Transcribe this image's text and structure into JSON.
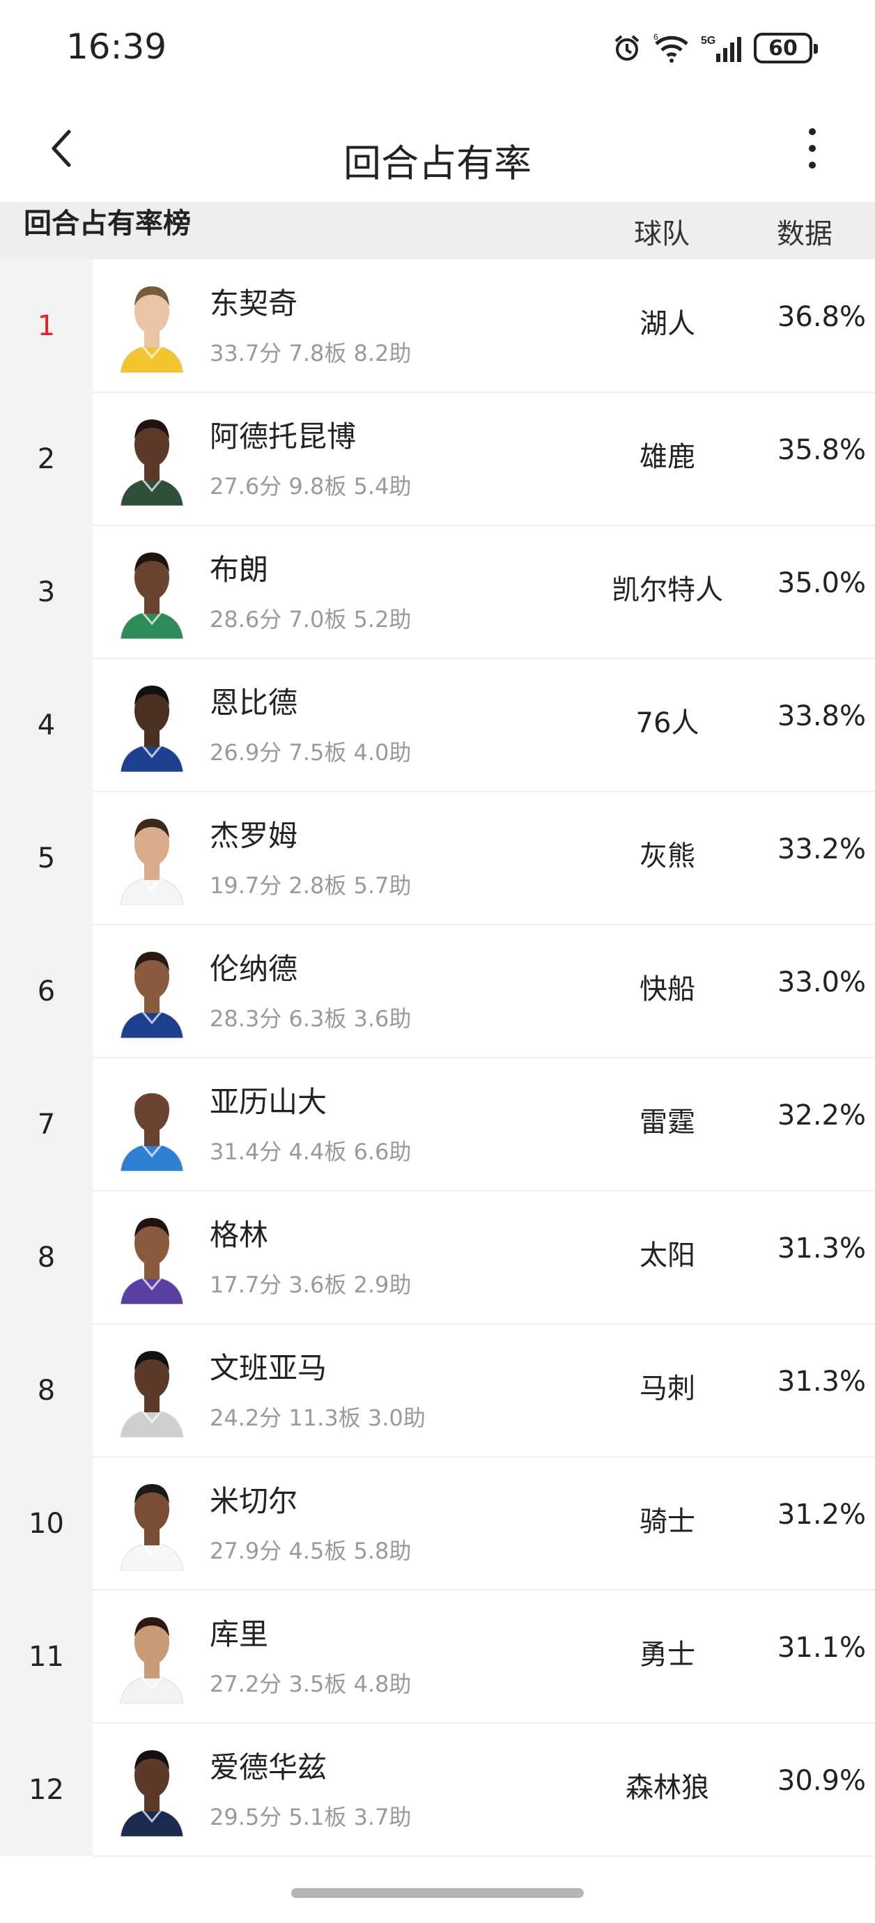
{
  "status_bar": {
    "time": "16:39",
    "battery": "60"
  },
  "nav": {
    "title": "回合占有率"
  },
  "table": {
    "title": "回合占有率榜",
    "col_team": "球队",
    "col_value": "数据",
    "rows": [
      {
        "rank": "1",
        "name": "东契奇",
        "stats": "33.7分 7.8板 8.2助",
        "team": "湖人",
        "value": "36.8%",
        "jersey": "#f4c430",
        "skin": "#e9c4a6",
        "hair": "#7a5a3c"
      },
      {
        "rank": "2",
        "name": "阿德托昆博",
        "stats": "27.6分 9.8板 5.4助",
        "team": "雄鹿",
        "value": "35.8%",
        "jersey": "#2f4f3a",
        "skin": "#5b3a29",
        "hair": "#1f1410"
      },
      {
        "rank": "3",
        "name": "布朗",
        "stats": "28.6分 7.0板 5.2助",
        "team": "凯尔特人",
        "value": "35.0%",
        "jersey": "#2e8b57",
        "skin": "#6b4431",
        "hair": "#1f1410"
      },
      {
        "rank": "4",
        "name": "恩比德",
        "stats": "26.9分 7.5板 4.0助",
        "team": "76人",
        "value": "33.8%",
        "jersey": "#1d3f8f",
        "skin": "#4a2f22",
        "hair": "#111111"
      },
      {
        "rank": "5",
        "name": "杰罗姆",
        "stats": "19.7分 2.8板 5.7助",
        "team": "灰熊",
        "value": "33.2%",
        "jersey": "#f5f5f5",
        "skin": "#d9ab8a",
        "hair": "#3b2a1c"
      },
      {
        "rank": "6",
        "name": "伦纳德",
        "stats": "28.3分 6.3板 3.6助",
        "team": "快船",
        "value": "33.0%",
        "jersey": "#1d3f8f",
        "skin": "#8a5a3f",
        "hair": "#2a1a12"
      },
      {
        "rank": "7",
        "name": "亚历山大",
        "stats": "31.4分 4.4板 6.6助",
        "team": "雷霆",
        "value": "32.2%",
        "jersey": "#2f7fd3",
        "skin": "#6b4431",
        "hair": "#ffffff"
      },
      {
        "rank": "8",
        "name": "格林",
        "stats": "17.7分 3.6板 2.9助",
        "team": "太阳",
        "value": "31.3%",
        "jersey": "#5b3fa0",
        "skin": "#8a5a3f",
        "hair": "#1f1410"
      },
      {
        "rank": "8",
        "name": "文班亚马",
        "stats": "24.2分 11.3板 3.0助",
        "team": "马刺",
        "value": "31.3%",
        "jersey": "#cfcfcf",
        "skin": "#5b3a29",
        "hair": "#111111"
      },
      {
        "rank": "10",
        "name": "米切尔",
        "stats": "27.9分 4.5板 5.8助",
        "team": "骑士",
        "value": "31.2%",
        "jersey": "#f7f7f7",
        "skin": "#7a4d36",
        "hair": "#1a1a1a"
      },
      {
        "rank": "11",
        "name": "库里",
        "stats": "27.2分 3.5板 4.8助",
        "team": "勇士",
        "value": "31.1%",
        "jersey": "#f2f2f2",
        "skin": "#c89a78",
        "hair": "#2a1a12"
      },
      {
        "rank": "12",
        "name": "爱德华兹",
        "stats": "29.5分 5.1板 3.7助",
        "team": "森林狼",
        "value": "30.9%",
        "jersey": "#1c2a4f",
        "skin": "#5b3a29",
        "hair": "#111111"
      }
    ]
  }
}
